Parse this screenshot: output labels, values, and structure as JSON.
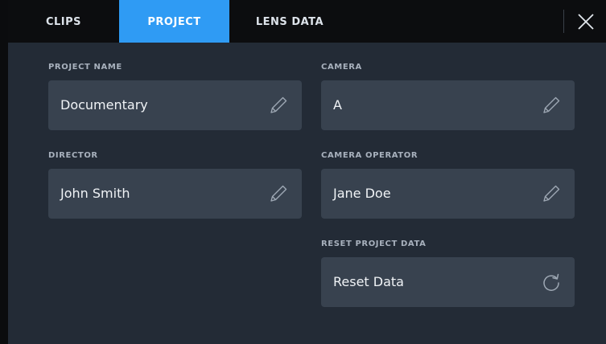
{
  "tabs": [
    {
      "label": "CLIPS",
      "active": false
    },
    {
      "label": "PROJECT",
      "active": true
    },
    {
      "label": "LENS DATA",
      "active": false
    }
  ],
  "fields": {
    "project_name": {
      "label": "PROJECT NAME",
      "value": "Documentary",
      "icon": "pencil-icon"
    },
    "camera": {
      "label": "CAMERA",
      "value": "A",
      "icon": "pencil-icon"
    },
    "director": {
      "label": "DIRECTOR",
      "value": "John Smith",
      "icon": "pencil-icon"
    },
    "camera_operator": {
      "label": "CAMERA OPERATOR",
      "value": "Jane Doe",
      "icon": "pencil-icon"
    },
    "reset": {
      "label": "RESET PROJECT DATA",
      "value": "Reset Data",
      "icon": "refresh-icon"
    }
  },
  "close_icon": "close-icon",
  "colors": {
    "accent": "#2f9bf4",
    "panel": "#232b36",
    "field": "#38424f",
    "tabbar": "#0c0d0f"
  }
}
